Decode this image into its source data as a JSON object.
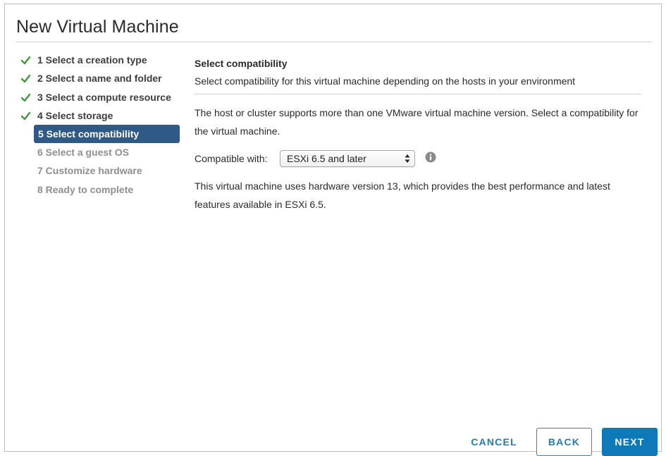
{
  "dialog": {
    "title": "New Virtual Machine"
  },
  "steps": [
    {
      "label": "1 Select a creation type",
      "state": "done"
    },
    {
      "label": "2 Select a name and folder",
      "state": "done"
    },
    {
      "label": "3 Select a compute resource",
      "state": "done"
    },
    {
      "label": "4 Select storage",
      "state": "done"
    },
    {
      "label": "5 Select compatibility",
      "state": "active"
    },
    {
      "label": "6 Select a guest OS",
      "state": "future"
    },
    {
      "label": "7 Customize hardware",
      "state": "future"
    },
    {
      "label": "8 Ready to complete",
      "state": "future"
    }
  ],
  "content": {
    "section_title": "Select compatibility",
    "section_desc": "Select compatibility for this virtual machine depending on the hosts in your environment",
    "intro": "The host or cluster supports more than one VMware virtual machine version. Select a compatibility for the virtual machine.",
    "compat_label": "Compatible with:",
    "compat_value": "ESXi 6.5 and later",
    "hardware_note": "This virtual machine uses hardware version 13, which provides the best performance and latest features available in ESXi 6.5."
  },
  "footer": {
    "cancel_label": "CANCEL",
    "back_label": "BACK",
    "next_label": "NEXT"
  },
  "colors": {
    "accent": "#0e79b8",
    "active_step": "#2f5a87",
    "check": "#3c9a3c"
  },
  "icons": {
    "done_step": "check-icon",
    "info": "info-icon",
    "select_arrows": "updown-arrows-icon"
  }
}
